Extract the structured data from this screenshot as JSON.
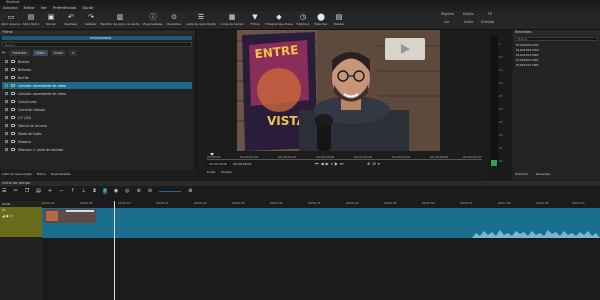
{
  "window": {
    "title": "Shotcut"
  },
  "menu": [
    "Arquivo",
    "Editar",
    "Ver",
    "Preferências",
    "Ajuda"
  ],
  "toolbar": [
    {
      "icon": "folder-open-icon",
      "label": "Abrir arquivo"
    },
    {
      "icon": "folder-icon",
      "label": "Abrir Outro"
    },
    {
      "icon": "save-icon",
      "label": "Salvar"
    },
    {
      "icon": "undo-icon",
      "label": "Desfazer"
    },
    {
      "icon": "redo-icon",
      "label": "Refazer"
    },
    {
      "icon": "audio-meter-icon",
      "label": "Medidor de picos de áudio"
    },
    {
      "icon": "properties-icon",
      "label": "Propriedades"
    },
    {
      "icon": "recent-icon",
      "label": "Recentes"
    },
    {
      "icon": "playlist-icon",
      "label": "Lista de reprodução"
    },
    {
      "icon": "timeline-icon",
      "label": "Linha de tempo"
    },
    {
      "icon": "filter-icon",
      "label": "Filtros"
    },
    {
      "icon": "keyframes-icon",
      "label": "Fotogramas-chave"
    },
    {
      "icon": "history-icon",
      "label": "Histórico"
    },
    {
      "icon": "export-icon",
      "label": "Exportar"
    },
    {
      "icon": "jobs-icon",
      "label": "Tarefas"
    }
  ],
  "layout_tabs": {
    "row1": [
      "Registro",
      "Edição",
      "FX"
    ],
    "row2": [
      "Cor",
      "Áudio",
      "Exibição"
    ]
  },
  "filters_panel": {
    "title": "Filtros",
    "selected_clip": "PUXADOUROS",
    "search_placeholder": "Buscar",
    "tabs": [
      "Favoritos",
      "Vídeo",
      "Áudio"
    ],
    "items": [
      "Bizarro",
      "Brilhado",
      "Borrão",
      "Cortado: ascendente do vídeo",
      "Cortado: ascendente de vídeo",
      "Ponteiro: saída de vídeo",
      "Color/Luzes",
      "Corrente vidrado",
      "C-F (2D)",
      "Gamut de recurso",
      "Modo de fusão",
      "Mosaico",
      "Máscara: Ir parte de teclado"
    ],
    "bottom_tabs": [
      "Lista de reprodução",
      "Filtros",
      "Propriedades"
    ]
  },
  "viewer": {
    "ruler_labels": [
      "00:00:00",
      "00:00:01:00",
      "00:00:02:00",
      "00:00:03:00",
      "00:00:04:00",
      "00:00:05:00",
      "00:00:06:00",
      "00:00:07:00"
    ],
    "current_time": "00:00:00:00",
    "duration": "00:00:58:04",
    "tabs": [
      "Fonte",
      "Projeto"
    ],
    "poster_text": "ENTRE ... VISTA"
  },
  "meter": {
    "labels": [
      "-5",
      "-10",
      "-15",
      "-20",
      "-25",
      "-30",
      "-35",
      "-40",
      "-45",
      "-50"
    ]
  },
  "recent": {
    "title": "Recentes",
    "search_placeholder": "Buscar",
    "files": [
      "P1002303.MOV",
      "P1002306.MOV",
      "P1002304.MP4",
      "P1002305.MP4",
      "P1002321.MP4"
    ],
    "bottom_tabs": [
      "Histórico",
      "Recentes"
    ]
  },
  "timeline": {
    "title": "Linha do tempo",
    "master_label": "Saída",
    "track_label": "V1",
    "ruler_labels": [
      "00:00:00",
      "00:00:05",
      "00:00:10",
      "00:00:15",
      "00:00:20",
      "00:00:25",
      "00:00:30",
      "00:00:35",
      "00:00:40",
      "00:00:45",
      "00:00:50",
      "00:00:55",
      "00:01:00",
      "00:01:05",
      "00:01:10",
      "00:01:15"
    ]
  },
  "colors": {
    "accent": "#1f6a8a",
    "track": "#1a6f8f",
    "track_head": "#6b6b1d"
  }
}
